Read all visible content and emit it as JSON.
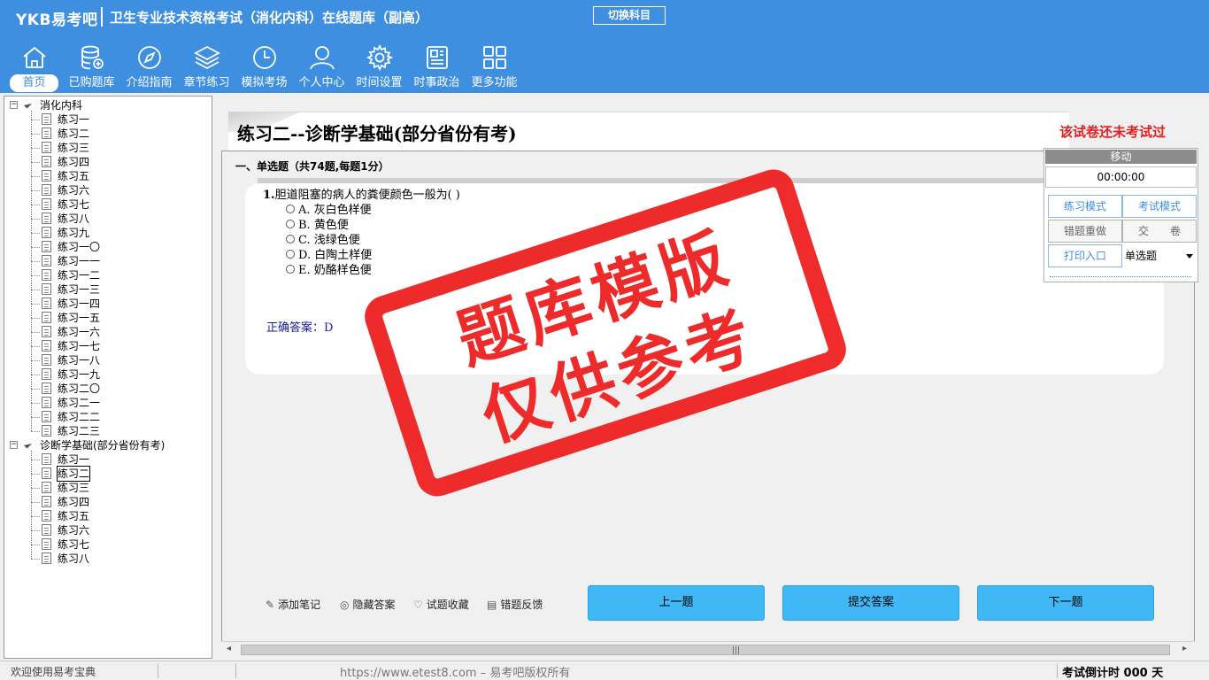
{
  "header": {
    "brand": "YKB易考吧",
    "title": "卫生专业技术资格考试（消化内科）在线题库（副高）",
    "switch_button": "切换科目"
  },
  "nav": [
    {
      "label": "首页",
      "icon": "home-icon",
      "active": true
    },
    {
      "label": "已购题库",
      "icon": "database-icon"
    },
    {
      "label": "介绍指南",
      "icon": "compass-icon"
    },
    {
      "label": "章节练习",
      "icon": "layers-icon"
    },
    {
      "label": "模拟考场",
      "icon": "clock-icon"
    },
    {
      "label": "个人中心",
      "icon": "user-icon"
    },
    {
      "label": "时间设置",
      "icon": "gear-icon"
    },
    {
      "label": "时事政治",
      "icon": "news-icon"
    },
    {
      "label": "更多功能",
      "icon": "grid-icon"
    }
  ],
  "tree": {
    "group1": {
      "label": "消化内科",
      "items": [
        "练习一",
        "练习二",
        "练习三",
        "练习四",
        "练习五",
        "练习六",
        "练习七",
        "练习八",
        "练习九",
        "练习一〇",
        "练习一一",
        "练习一二",
        "练习一三",
        "练习一四",
        "练习一五",
        "练习一六",
        "练习一七",
        "练习一八",
        "练习一九",
        "练习二〇",
        "练习二一",
        "练习二二",
        "练习二三"
      ]
    },
    "group2": {
      "label": "诊断学基础(部分省份有考)",
      "items": [
        "练习一",
        "练习二",
        "练习三",
        "练习四",
        "练习五",
        "练习六",
        "练习七",
        "练习八"
      ],
      "selected_index": 1
    }
  },
  "main": {
    "page_title": "练习二--诊断学基础(部分省份有考)",
    "status_notice": "该试卷还未考试过",
    "section_header": "一、单选题（共74题,每题1分）",
    "question": {
      "number": "1.",
      "text": "胆道阻塞的病人的粪便颜色一般为( )",
      "options": [
        "A. 灰白色样便",
        "B. 黄色便",
        "C. 浅绿色便",
        "D. 白陶土样便",
        "E. 奶酪样色便"
      ],
      "answer": "正确答案：D"
    },
    "tools": [
      "添加笔记",
      "隐藏答案",
      "试题收藏",
      "错题反馈"
    ],
    "buttons": {
      "prev": "上一题",
      "submit": "提交答案",
      "next": "下一题"
    }
  },
  "panel": {
    "move_label": "移动",
    "timer": "00:00:00",
    "practice_mode": "练习模式",
    "exam_mode": "考试模式",
    "redo_wrong": "错题重做",
    "submit_paper": "交　　卷",
    "print": "打印入口",
    "type_select": "单选题"
  },
  "stamp": {
    "line1": "题库模版",
    "line2": "仅供参考"
  },
  "status": {
    "welcome": "欢迎使用易考宝典",
    "url": "https://www.etest8.com – 易考吧版权所有",
    "countdown": "考试倒计时 000 天"
  }
}
